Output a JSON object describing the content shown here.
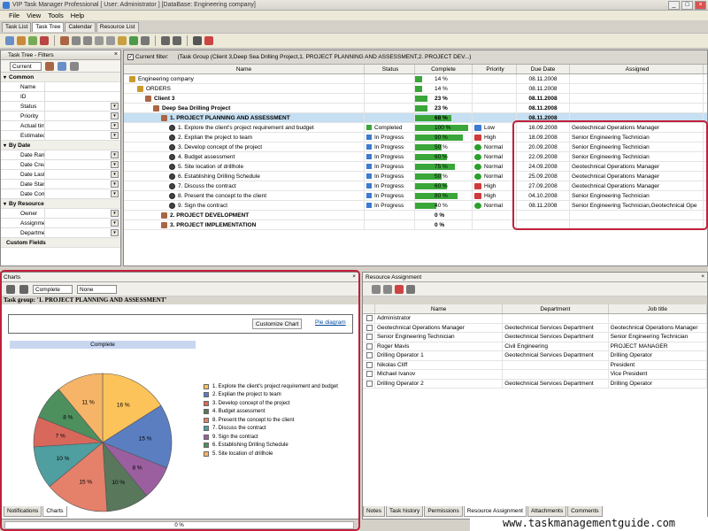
{
  "window": {
    "title": "VIP Task Manager Professional [ User: Administrator ] [DataBase: Engineering company]"
  },
  "menu": [
    "File",
    "View",
    "Tools",
    "Help"
  ],
  "tabs": [
    {
      "label": "Task List",
      "active": false
    },
    {
      "label": "Task Tree",
      "active": true
    },
    {
      "label": "Calendar",
      "active": false
    },
    {
      "label": "Resource List",
      "active": false
    }
  ],
  "filters": {
    "title": "Task Tree - Filters",
    "current": "Current",
    "sections": [
      {
        "label": "Common",
        "items": [
          "Name",
          "ID",
          "Status",
          "Priority",
          "Actual time",
          "Estimated Ti"
        ]
      },
      {
        "label": "By Date",
        "items": [
          "Date Range",
          "Date Create",
          "Date Last M",
          "Date Started",
          "Date Compl"
        ]
      },
      {
        "label": "By Resource",
        "items": [
          "Owner",
          "Assignment",
          "Department"
        ]
      },
      {
        "label": "Custom Fields",
        "items": []
      }
    ]
  },
  "current_filter": {
    "label": "Current filter:",
    "value": "(Task Group  (Client 3,Deep Sea Drilling Project,1. PROJECT PLANNING AND ASSESSMENT,2. PROJECT DEV...)"
  },
  "grid": {
    "columns": [
      "Name",
      "Status",
      "Complete",
      "Priority",
      "Due Date",
      "Assigned"
    ],
    "rows": [
      {
        "indent": 0,
        "icon": "folder",
        "name": "Engineering company",
        "bold": false,
        "status": "",
        "complete": 14,
        "complete_label": "14 %",
        "priority": "",
        "due": "08.11.2008",
        "assigned": ""
      },
      {
        "indent": 1,
        "icon": "folder",
        "name": "ORDERS",
        "bold": false,
        "status": "",
        "complete": 14,
        "complete_label": "14 %",
        "priority": "",
        "due": "08.11.2008",
        "assigned": ""
      },
      {
        "indent": 2,
        "icon": "filter",
        "name": "Client 3",
        "bold": true,
        "status": "",
        "complete": 23,
        "complete_label": "23 %",
        "priority": "",
        "due": "08.11.2008",
        "assigned": ""
      },
      {
        "indent": 3,
        "icon": "filter",
        "name": "Deep Sea Drilling Project",
        "bold": true,
        "status": "",
        "complete": 23,
        "complete_label": "23 %",
        "priority": "",
        "due": "08.11.2008",
        "assigned": ""
      },
      {
        "indent": 4,
        "icon": "filter",
        "name": "1. PROJECT PLANNING AND ASSESSMENT",
        "bold": true,
        "selected": true,
        "status": "",
        "complete": 68,
        "complete_label": "68 %",
        "priority": "",
        "due": "08.11.2008",
        "assigned": ""
      },
      {
        "indent": 5,
        "icon": "gear",
        "name": "1. Explore the client's project requirement and budget",
        "status": "Completed",
        "status_color": "#3aa63a",
        "complete": 100,
        "complete_label": "100 %",
        "priority": "Low",
        "priority_color": "#3b7bd1",
        "due": "16.09.2008",
        "assigned": "Geotechnical Operations Manager"
      },
      {
        "indent": 5,
        "icon": "gear",
        "name": "2. Explian the project to team",
        "status": "In Progress",
        "status_color": "#3b7bd1",
        "complete": 90,
        "complete_label": "90 %",
        "priority": "High",
        "priority_color": "#d03a3a",
        "due": "18.09.2008",
        "assigned": "Senior Engineering Technician"
      },
      {
        "indent": 5,
        "icon": "gear",
        "name": "3. Develop concept of the project",
        "status": "In Progress",
        "status_color": "#3b7bd1",
        "complete": 50,
        "complete_label": "50 %",
        "priority": "Normal",
        "priority_color": "#2aa02a",
        "due": "20.09.2008",
        "assigned": "Senior Engineering Technician"
      },
      {
        "indent": 5,
        "icon": "gear",
        "name": "4. Budget assessment",
        "status": "In Progress",
        "status_color": "#3b7bd1",
        "complete": 60,
        "complete_label": "60 %",
        "priority": "Normal",
        "priority_color": "#2aa02a",
        "due": "22.09.2008",
        "assigned": "Senior Engineering Technician"
      },
      {
        "indent": 5,
        "icon": "gear",
        "name": "5. Site location of drillhole",
        "status": "In Progress",
        "status_color": "#3b7bd1",
        "complete": 75,
        "complete_label": "75 %",
        "priority": "Normal",
        "priority_color": "#2aa02a",
        "due": "24.09.2008",
        "assigned": "Geotechnical Operations Manager"
      },
      {
        "indent": 5,
        "icon": "gear",
        "name": "6. Establishing Drilling Schedule",
        "status": "In Progress",
        "status_color": "#3b7bd1",
        "complete": 50,
        "complete_label": "50 %",
        "priority": "Normal",
        "priority_color": "#2aa02a",
        "due": "25.09.2008",
        "assigned": "Geotechnical Operations Manager"
      },
      {
        "indent": 5,
        "icon": "gear",
        "name": "7. Discuss the contract",
        "status": "In Progress",
        "status_color": "#3b7bd1",
        "complete": 60,
        "complete_label": "60 %",
        "priority": "High",
        "priority_color": "#d03a3a",
        "due": "27.09.2008",
        "assigned": "Geotechnical Operations Manager"
      },
      {
        "indent": 5,
        "icon": "gear",
        "name": "8. Present the concept to the client",
        "status": "In Progress",
        "status_color": "#3b7bd1",
        "complete": 80,
        "complete_label": "80 %",
        "priority": "High",
        "priority_color": "#d03a3a",
        "due": "04.10.2008",
        "assigned": "Senior Engineering Technician"
      },
      {
        "indent": 5,
        "icon": "gear",
        "name": "9. Sign the contract",
        "status": "In Progress",
        "status_color": "#3b7bd1",
        "complete": 40,
        "complete_label": "40 %",
        "priority": "Normal",
        "priority_color": "#2aa02a",
        "due": "08.11.2008",
        "assigned": "Senior Engineering Technician,Geotechnical Ope"
      },
      {
        "indent": 4,
        "icon": "filter",
        "name": "2. PROJECT DEVELOPMENT",
        "bold": true,
        "status": "",
        "complete": 0,
        "complete_label": "0 %",
        "priority": "",
        "due": "",
        "assigned": ""
      },
      {
        "indent": 4,
        "icon": "filter",
        "name": "3. PROJECT IMPLEMENTATION",
        "bold": true,
        "status": "",
        "complete": 0,
        "complete_label": "0 %",
        "priority": "",
        "due": "",
        "assigned": ""
      }
    ]
  },
  "charts": {
    "panel_title": "Charts",
    "select1": "Complete",
    "select2": "None",
    "group_label": "Task group: '1. PROJECT PLANNING AND ASSESSMENT'",
    "customize_label": "Customize Chart",
    "pie_link": "Pie diagram",
    "chart_title": "Complete"
  },
  "chart_data": {
    "type": "pie",
    "title": "Complete",
    "legend_position": "right",
    "slices": [
      {
        "label": "1. Explore the client's project requirement and budget",
        "value": 16,
        "text": "16 %",
        "color": "#fcc35a"
      },
      {
        "label": "2. Explian the project to team",
        "value": 15,
        "text": "15 %",
        "color": "#5b7ec0"
      },
      {
        "label": "9. Sign the contract",
        "value": 8,
        "text": "8 %",
        "color": "#9b5fa0"
      },
      {
        "label": "4. Budget assessment",
        "value": 10,
        "text": "10 %",
        "color": "#59775b"
      },
      {
        "label": "8. Present the concept to the client",
        "value": 15,
        "text": "15 %",
        "color": "#e5806b"
      },
      {
        "label": "7. Discuss the contract",
        "value": 10,
        "text": "10 %",
        "color": "#4f9ea0"
      },
      {
        "label": "3. Develop concept of the project",
        "value": 7,
        "text": "7 %",
        "color": "#d9685c"
      },
      {
        "label": "6. Establishing Drilling Schedule",
        "value": 8,
        "text": "8 %",
        "color": "#4e8f5e"
      },
      {
        "label": "5. Site location of drillhole",
        "value": 11,
        "text": "11 %",
        "color": "#f6b468"
      }
    ],
    "legend_order": [
      {
        "label": "1. Explore the client's project requirement and budget",
        "color": "#fcc35a"
      },
      {
        "label": "2. Explian the project to team",
        "color": "#5b7ec0"
      },
      {
        "label": "3. Develop concept of the project",
        "color": "#d9685c"
      },
      {
        "label": "4. Budget assessment",
        "color": "#59775b"
      },
      {
        "label": "8. Present the concept to the client",
        "color": "#e5806b"
      },
      {
        "label": "7. Discuss the contract",
        "color": "#4f9ea0"
      },
      {
        "label": "9. Sign the contract",
        "color": "#9b5fa0"
      },
      {
        "label": "6. Establishing Drilling Schedule",
        "color": "#4e8f5e"
      },
      {
        "label": "5. Site location of drillhole",
        "color": "#f6b468"
      }
    ]
  },
  "bottom_tabs_left": [
    {
      "label": "Notifications",
      "active": false
    },
    {
      "label": "Charts",
      "active": true
    }
  ],
  "statusbar": {
    "progress": "0 %"
  },
  "resources": {
    "panel_title": "Resource Assignment",
    "columns": [
      "Name",
      "Department",
      "Job title"
    ],
    "rows": [
      {
        "name": "Administrator",
        "department": "",
        "job": ""
      },
      {
        "name": "Geotechnical Operations Manager",
        "department": "Geotechnical Services Department",
        "job": "Geotechnical Operations Manager"
      },
      {
        "name": "Senior Engineering Technician",
        "department": "Geotechnical Services Department",
        "job": "Senior Engineering Technician"
      },
      {
        "name": "Roger Mavis",
        "department": "Civil Engineering",
        "job": "PROJECT MANAGER"
      },
      {
        "name": "Drilling Operator 1",
        "department": "Geotechnical Services Department",
        "job": "Drilling Operator"
      },
      {
        "name": "Nikolas Cliff",
        "department": "",
        "job": "President"
      },
      {
        "name": "Michael Ivanov",
        "department": "",
        "job": "Vice President"
      },
      {
        "name": "Drilling Operator 2",
        "department": "Geotechnical Services Department",
        "job": "Drilling Operator"
      }
    ]
  },
  "bottom_tabs_right": [
    {
      "label": "Notes",
      "active": false
    },
    {
      "label": "Task history",
      "active": false
    },
    {
      "label": "Permissions",
      "active": false
    },
    {
      "label": "Resource Assignment",
      "active": true
    },
    {
      "label": "Attachments",
      "active": false
    },
    {
      "label": "Comments",
      "active": false
    }
  ],
  "watermark": "www.taskmanagementguide.com"
}
